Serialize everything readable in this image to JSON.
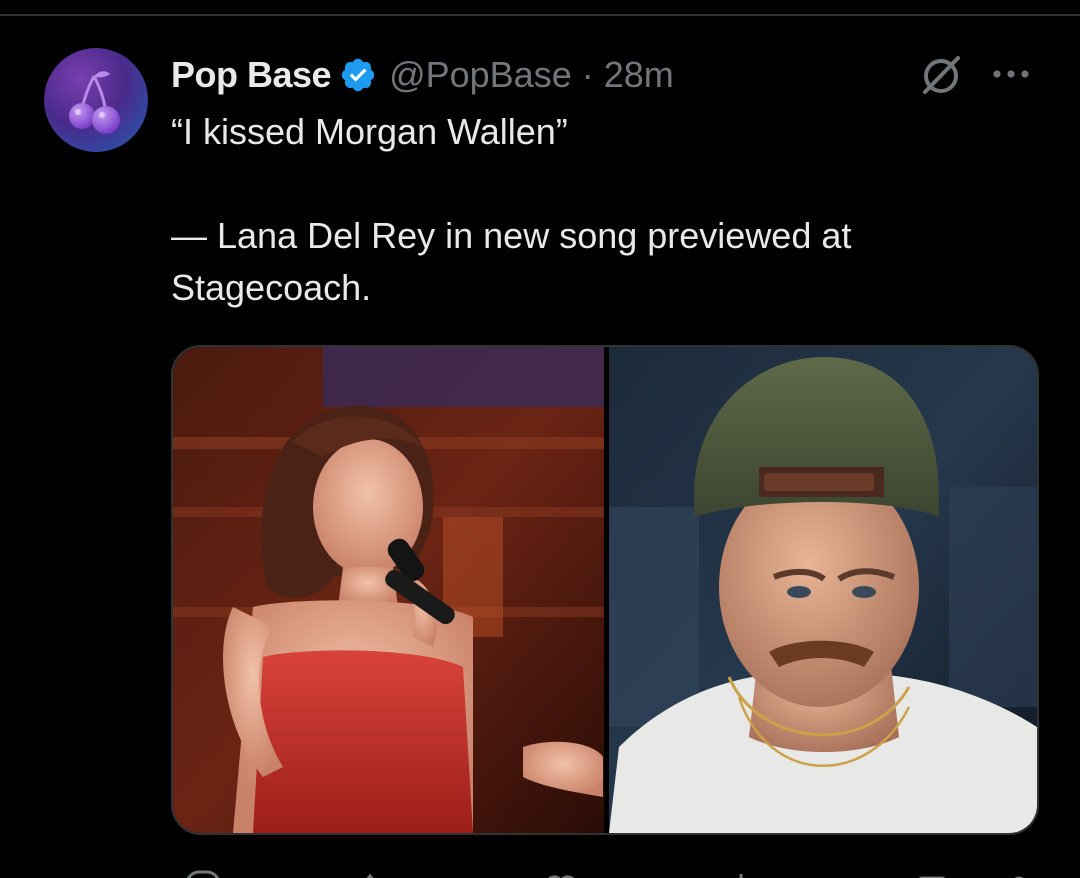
{
  "tweet": {
    "display_name": "Pop Base",
    "handle": "@PopBase",
    "separator": "·",
    "time": "28m",
    "text_line1": "“I kissed Morgan Wallen”",
    "text_line2": "— Lana Del Rey in new song previewed at Stagecoach.",
    "verified": true,
    "avatar_icon": "cherry-icon",
    "media": [
      {
        "name": "lana-del-rey-photo",
        "description_icon": "photo"
      },
      {
        "name": "morgan-wallen-photo",
        "description_icon": "photo"
      }
    ]
  },
  "icons": {
    "verified": "verified-badge-icon",
    "grok": "grok-icon",
    "more": "more-icon",
    "actions": [
      "reply-icon",
      "repost-icon",
      "like-icon",
      "views-icon",
      "bookmark-icon",
      "share-icon"
    ]
  },
  "colors": {
    "background": "#000000",
    "text_primary": "#e7e9ea",
    "text_secondary": "#71767b",
    "verified_blue": "#1d9bf0",
    "divider": "#2f3336"
  }
}
